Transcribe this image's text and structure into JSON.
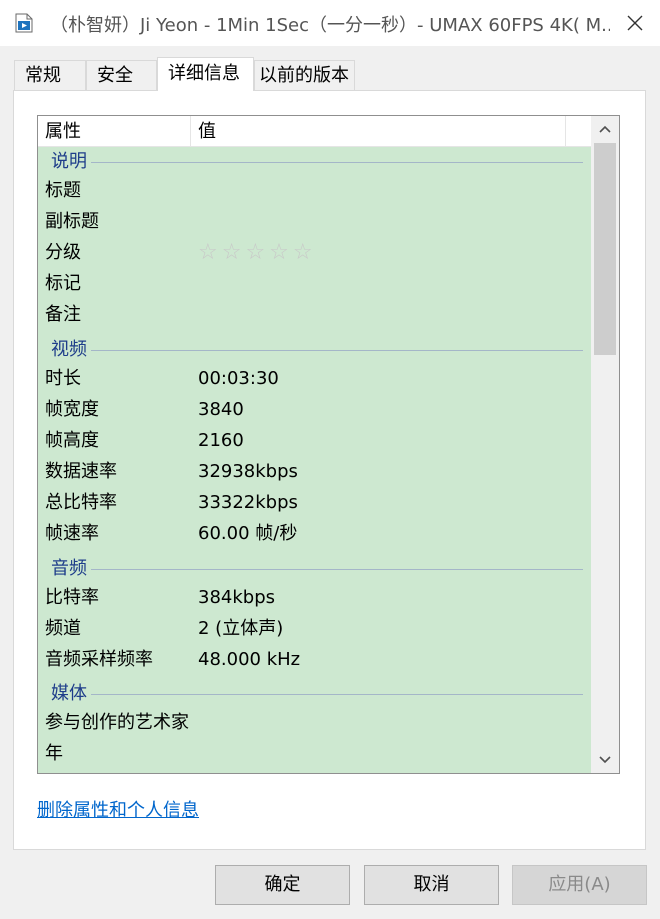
{
  "window": {
    "title": "（朴智妍）Ji Yeon - 1Min 1Sec（一分一秒）- UMAX 60FPS  4K( M..."
  },
  "tabs": [
    {
      "label": "常规"
    },
    {
      "label": "安全"
    },
    {
      "label": "详细信息",
      "active": true
    },
    {
      "label": "以前的版本"
    }
  ],
  "list": {
    "headers": {
      "property": "属性",
      "value": "值"
    },
    "groups": {
      "description": {
        "label": "说明",
        "rows": [
          {
            "name": "标题",
            "value": ""
          },
          {
            "name": "副标题",
            "value": ""
          },
          {
            "name": "分级",
            "value": "",
            "rating": 0,
            "max_rating": 5
          },
          {
            "name": "标记",
            "value": ""
          },
          {
            "name": "备注",
            "value": ""
          }
        ]
      },
      "video": {
        "label": "视频",
        "rows": [
          {
            "name": "时长",
            "value": "00:03:30"
          },
          {
            "name": "帧宽度",
            "value": "3840"
          },
          {
            "name": "帧高度",
            "value": "2160"
          },
          {
            "name": "数据速率",
            "value": "32938kbps"
          },
          {
            "name": "总比特率",
            "value": "33322kbps"
          },
          {
            "name": "帧速率",
            "value": "60.00 帧/秒"
          }
        ]
      },
      "audio": {
        "label": "音频",
        "rows": [
          {
            "name": "比特率",
            "value": "384kbps"
          },
          {
            "name": "频道",
            "value": "2 (立体声)"
          },
          {
            "name": "音频采样频率",
            "value": "48.000 kHz"
          }
        ]
      },
      "media": {
        "label": "媒体",
        "rows": [
          {
            "name": "参与创作的艺术家",
            "value": ""
          },
          {
            "name": "年",
            "value": ""
          }
        ]
      }
    },
    "star_glyphs": "☆☆☆☆☆"
  },
  "links": {
    "remove_properties": "删除属性和个人信息"
  },
  "buttons": {
    "ok": "确定",
    "cancel": "取消",
    "apply": "应用(A)"
  },
  "colors": {
    "list_background": "#cde8d0",
    "group_label": "#1e3d8a",
    "link": "#0066cc"
  },
  "icons": {
    "app": "video-file-icon",
    "close": "close-icon",
    "scroll_up": "chevron-up-icon",
    "scroll_down": "chevron-down-icon"
  }
}
